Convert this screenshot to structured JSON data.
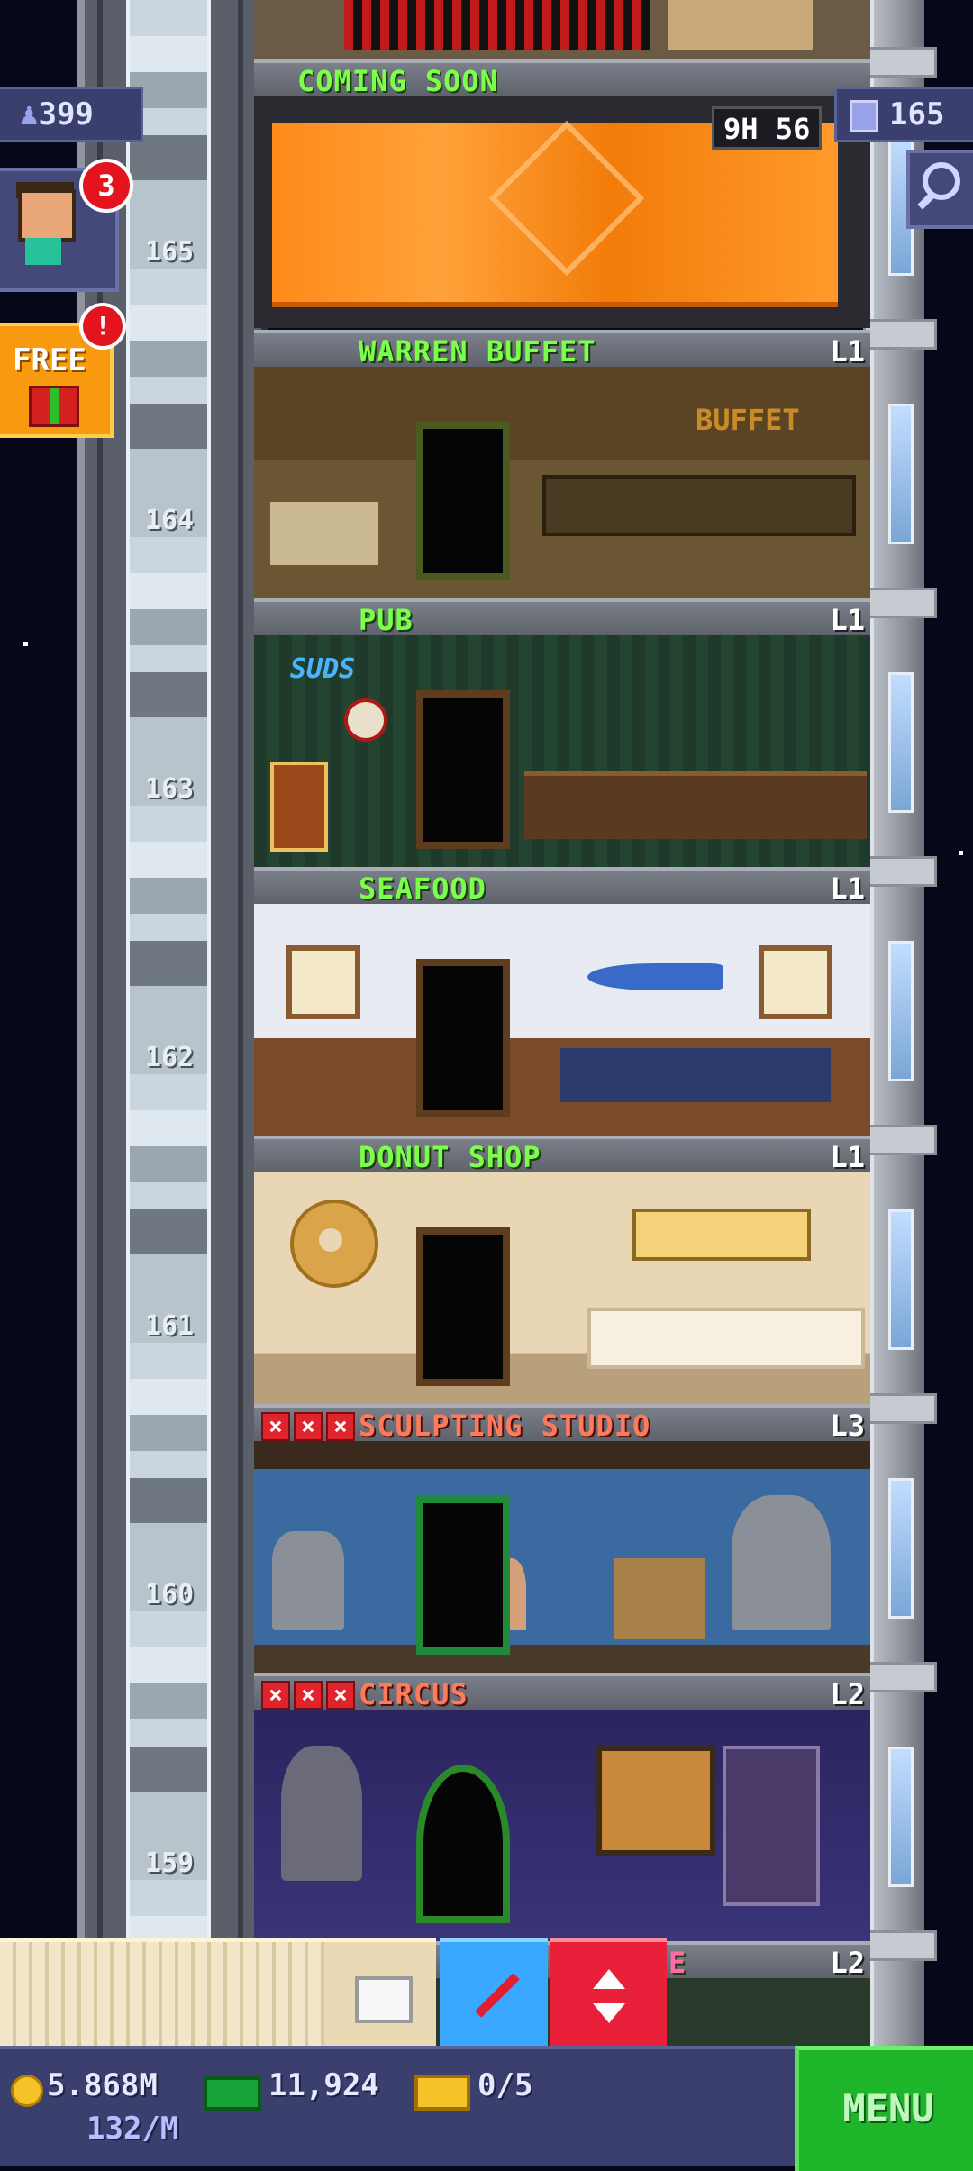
{
  "hud": {
    "population": "399",
    "floor_count": "165",
    "visitor_badge": "3",
    "free_label": "FREE",
    "free_badge": "!"
  },
  "tower": {
    "construction": {
      "name": "COMING SOON",
      "timer": "9H 56"
    },
    "floors": [
      {
        "number": "165",
        "name": "WARREN BUFFET",
        "level": "L1",
        "stars_missing": 0
      },
      {
        "number": "164",
        "name": "PUB",
        "level": "L1",
        "stars_missing": 0
      },
      {
        "number": "163",
        "name": "SEAFOOD",
        "level": "L1",
        "stars_missing": 0
      },
      {
        "number": "162",
        "name": "DONUT SHOP",
        "level": "L1",
        "stars_missing": 0
      },
      {
        "number": "161",
        "name": "SCULPTING STUDIO",
        "level": "L3",
        "stars_missing": 3
      },
      {
        "number": "160",
        "name": "CIRCUS",
        "level": "L2",
        "stars_missing": 3
      },
      {
        "number": "159",
        "name": "E",
        "level": "L2",
        "stars_missing": 0
      }
    ],
    "shaft_labels": [
      "165",
      "164",
      "163",
      "162",
      "161",
      "160",
      "159"
    ]
  },
  "room_signs": {
    "buffet": "BUFFET",
    "suds": "SUDS"
  },
  "status": {
    "coins": "5.868M",
    "income": "132/M",
    "bux": "11,924",
    "tickets": "0/5",
    "menu_label": "MENU"
  },
  "colors": {
    "floor_name_ok": "#7cff4a",
    "floor_name_warn": "#ff7a5c",
    "construction": "#ff9a2a",
    "menu": "#1fb52a",
    "hud": "#3a3f6e"
  }
}
